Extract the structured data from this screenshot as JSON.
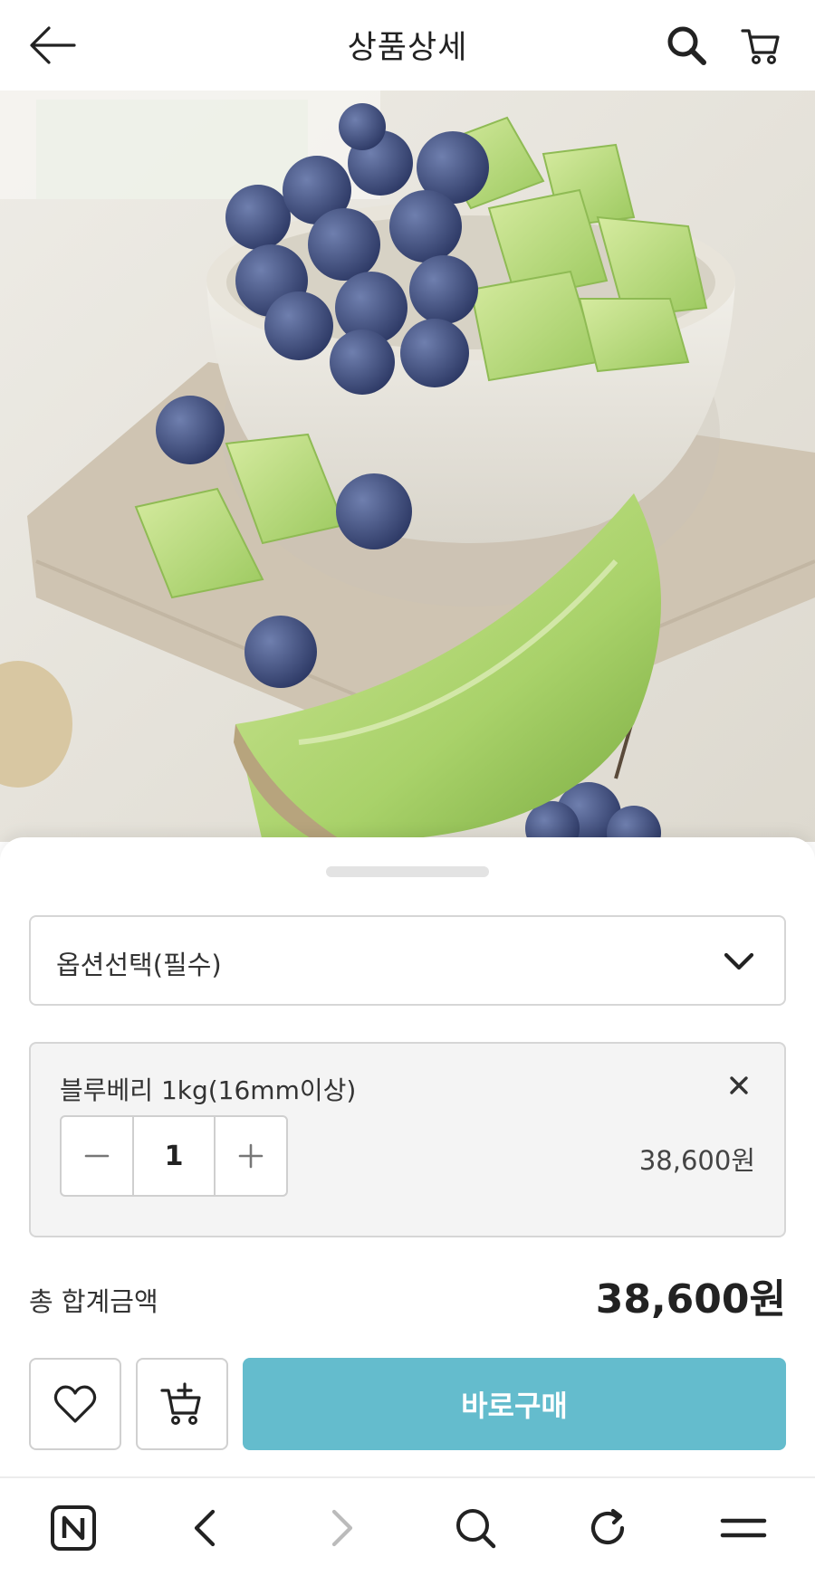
{
  "header": {
    "title": "상품상세"
  },
  "icons": {
    "back": "arrow-left-icon",
    "search": "search-icon",
    "cart": "cart-icon"
  },
  "option_select": {
    "placeholder": "옵션선택(필수)"
  },
  "selected_option": {
    "name": "블루베리 1kg(16mm이상)",
    "quantity": "1",
    "price": "38,600원"
  },
  "total": {
    "label": "총 합계금액",
    "value": "38,600원"
  },
  "actions": {
    "buy_label": "바로구매"
  },
  "colors": {
    "accent": "#64bccd"
  }
}
